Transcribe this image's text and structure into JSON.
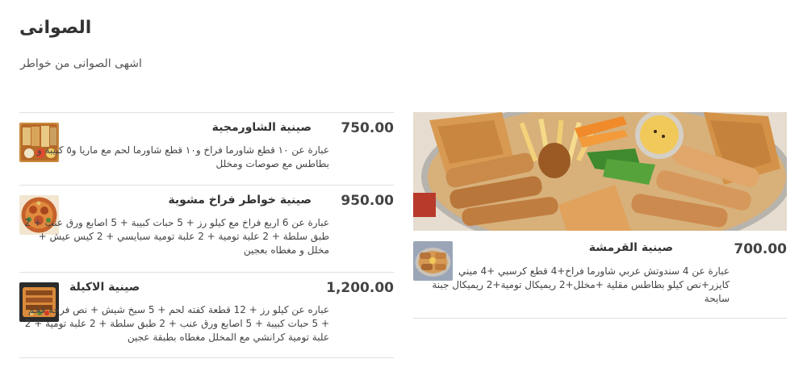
{
  "header": {
    "title": "الصوانى",
    "subtitle": "اشهى الصوانى من خواطر"
  },
  "items": [
    {
      "name": "صينية الشاورمجية",
      "price": "750.00",
      "description": "عبارة عن ١٠ قطع شاورما فراخ و١٠ قطع شاورما لحم مع ماريا و٥ كبيبة و بطاطس مع صوصات ومخلل"
    },
    {
      "name": "صينية خواطر فراخ مشوية",
      "price": "950.00",
      "description": "عبارة عن 6 اربع فراخ مع كيلو رز + 5 حبات كبيبة + 5 اصابع ورق عنب + 2 طبق سلطة + 2 علبة تومية + 2 علبة تومية سبايسي + 2 كيس عيش + مخلل و مغطاه بعجين"
    },
    {
      "name": "صينية الاكيلة",
      "price": "1,200.00",
      "description": "عباره عن كيلو رز + 12 قطعة كفته لحم + 5 سيخ شيش + نص فرخه فحم + 5 حبات كبيبة + 5 اصابع ورق عنب + 2 طبق سلطة + 2 علبة تومية + 2 علبة تومية كرانشي مع المخلل مغطاه بطبقة عجين"
    }
  ],
  "featured": {
    "name": "صينية القرمشة",
    "price": "700.00",
    "description": "عبارة عن 4 سندوتش عربي شاورما فراخ+4 قطع كرسبي +4 ميني كايزر+نص كيلو بطاطس مقلية +مخلل+2 ريميكال تومية+2 ريميكال جبنة سايحة"
  }
}
